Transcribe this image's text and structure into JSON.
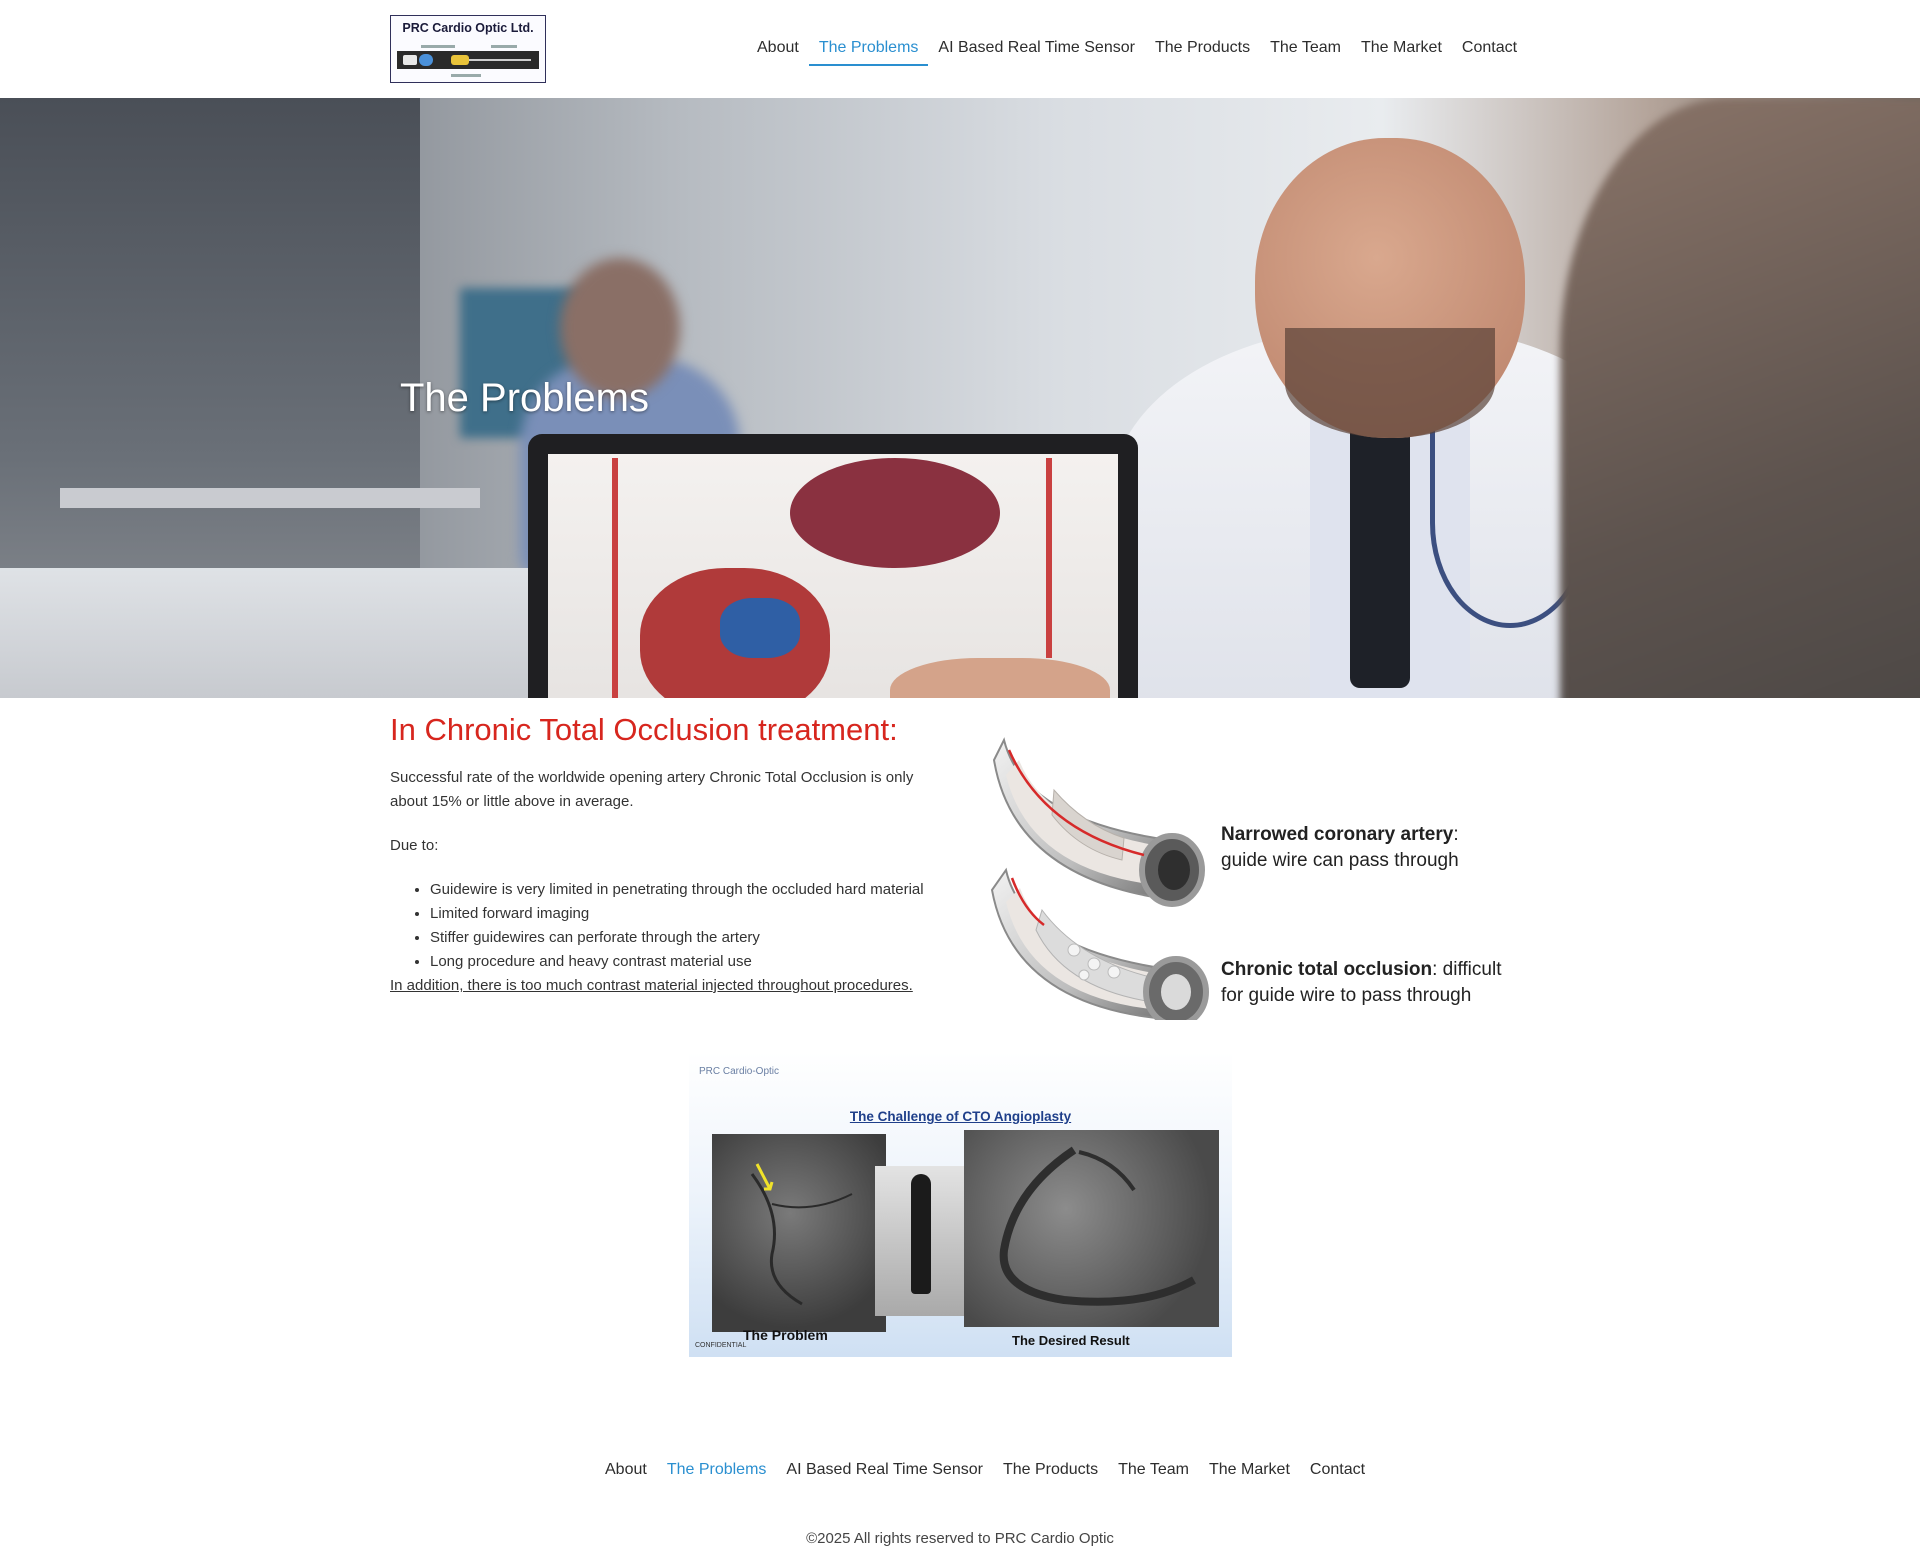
{
  "header": {
    "logo": {
      "title": "PRC Cardio Optic Ltd."
    },
    "nav": [
      {
        "label": "About",
        "active": false
      },
      {
        "label": "The Problems",
        "active": true
      },
      {
        "label": "AI Based Real Time Sensor",
        "active": false
      },
      {
        "label": "The Products",
        "active": false
      },
      {
        "label": "The Team",
        "active": false
      },
      {
        "label": "The Market",
        "active": false
      },
      {
        "label": "Contact",
        "active": false
      }
    ]
  },
  "hero": {
    "title": "The Problems"
  },
  "content": {
    "heading": "In Chronic Total Occlusion treatment:",
    "paragraph1": "Successful rate of the worldwide opening artery Chronic Total Occlusion is only about 15% or little above in average.",
    "paragraph2": "Due to:",
    "reasons": [
      "Guidewire is very limited in penetrating through the occluded hard material",
      "Limited forward imaging",
      "Stiffer guidewires can perforate through the artery",
      "Long procedure and heavy contrast material use"
    ],
    "note": "In addition, there is too much contrast material injected throughout procedures."
  },
  "artery_figure": {
    "caption1_bold": "Narrowed coronary artery",
    "caption1_colon": ":",
    "caption1_rest": "guide wire can pass through",
    "caption2_bold": "Chronic total occlusion",
    "caption2_colon": ":  difficult",
    "caption2_rest": "for guide wire to pass through"
  },
  "cto_slide": {
    "brand": "PRC Cardio-Optic",
    "title": "The Challenge of CTO Angioplasty",
    "label_problem": "The Problem",
    "label_result": "The Desired Result",
    "confidential": "CONFIDENTIAL"
  },
  "footer": {
    "nav": [
      {
        "label": "About",
        "active": false
      },
      {
        "label": "The Problems",
        "active": true
      },
      {
        "label": "AI Based Real Time Sensor",
        "active": false
      },
      {
        "label": "The Products",
        "active": false
      },
      {
        "label": "The Team",
        "active": false
      },
      {
        "label": "The Market",
        "active": false
      },
      {
        "label": "Contact",
        "active": false
      }
    ],
    "copyright": "©2025 All rights reserved to PRC Cardio Optic"
  },
  "colors": {
    "accent": "#2a8fd0",
    "heading_red": "#d7261e",
    "text": "#333333"
  }
}
